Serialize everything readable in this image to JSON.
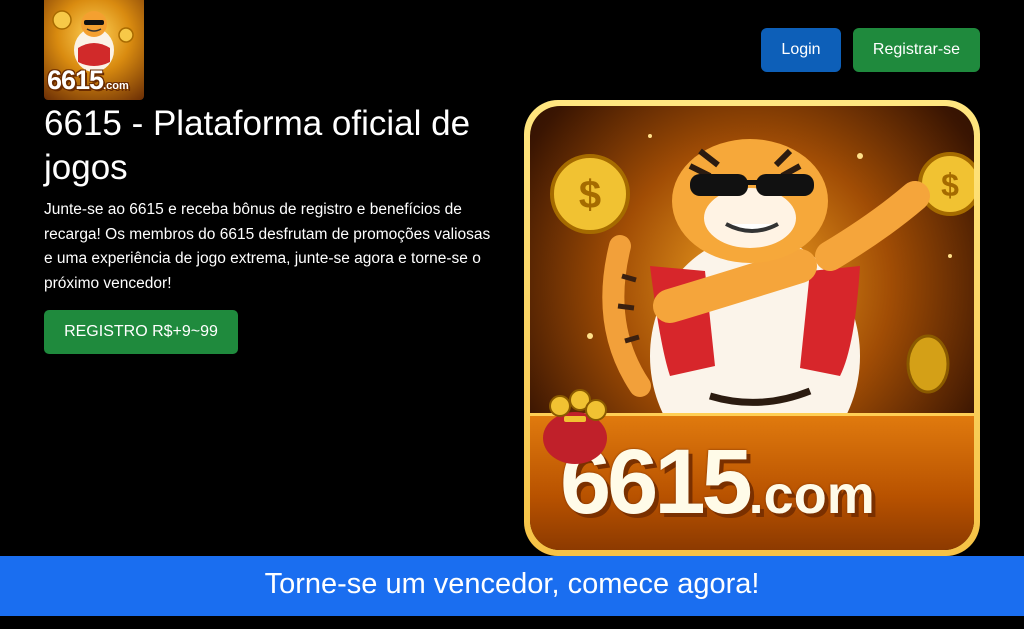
{
  "header": {
    "logo": {
      "text": "6615",
      "suffix": ".com"
    },
    "login_label": "Login",
    "register_label": "Registrar-se"
  },
  "hero": {
    "title": "6615 - Plataforma oficial de jogos",
    "description": "Junte-se ao 6615 e receba bônus de registro e benefícios de recarga! Os membros do 6615 desfrutam de promoções valiosas e uma experiência de jogo extrema, junte-se agora e torne-se o próximo vencedor!",
    "cta_label": "REGISTRO R$+9~99",
    "image": {
      "brand_text": "6615",
      "brand_suffix": ".com"
    }
  },
  "banner": {
    "text": "Torne-se um vencedor, comece agora!"
  },
  "colors": {
    "background": "#000000",
    "login_button": "#0d5fb8",
    "register_button": "#1f8a3d",
    "cta_button": "#1f8a3d",
    "banner": "#1a6ef0"
  }
}
